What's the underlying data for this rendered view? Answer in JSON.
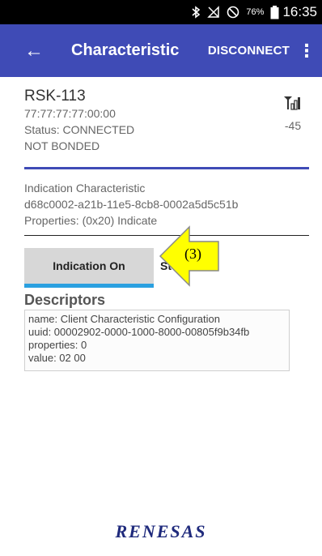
{
  "status_bar": {
    "battery_percent": "76%",
    "time": "16:35",
    "icons": [
      "bluetooth-icon",
      "no-signal-icon",
      "dnd-icon",
      "battery-icon"
    ]
  },
  "app_bar": {
    "title": "Characteristic",
    "disconnect_label": "DISCONNECT",
    "menu_label": "⋮",
    "back_label": "←"
  },
  "device": {
    "name": "RSK-113",
    "address": "77:77:77:77:00:00",
    "status": "Status: CONNECTED",
    "bond": "NOT BONDED",
    "rssi": "-45"
  },
  "characteristic": {
    "name": "Indication Characteristic",
    "uuid": "d68c0002-a21b-11e5-8cb8-0002a5d5c51b",
    "properties": "Properties: (0x20) Indicate"
  },
  "buttons": {
    "indication_on": "Indication On",
    "stop": "Stop"
  },
  "annotation": {
    "label": "(3)"
  },
  "descriptors": {
    "heading": "Descriptors",
    "items": [
      {
        "name": "name: Client Characteristic Configuration",
        "uuid": "uuid: 00002902-0000-1000-8000-00805f9b34fb",
        "properties": "properties: 0",
        "value": "value: 02 00"
      }
    ]
  },
  "branding": {
    "logo_text": "RENESAS"
  },
  "colors": {
    "app_bar": "#3f4bb6",
    "accent_underline": "#2aa0e0",
    "annotation_arrow": "#ffff00"
  }
}
